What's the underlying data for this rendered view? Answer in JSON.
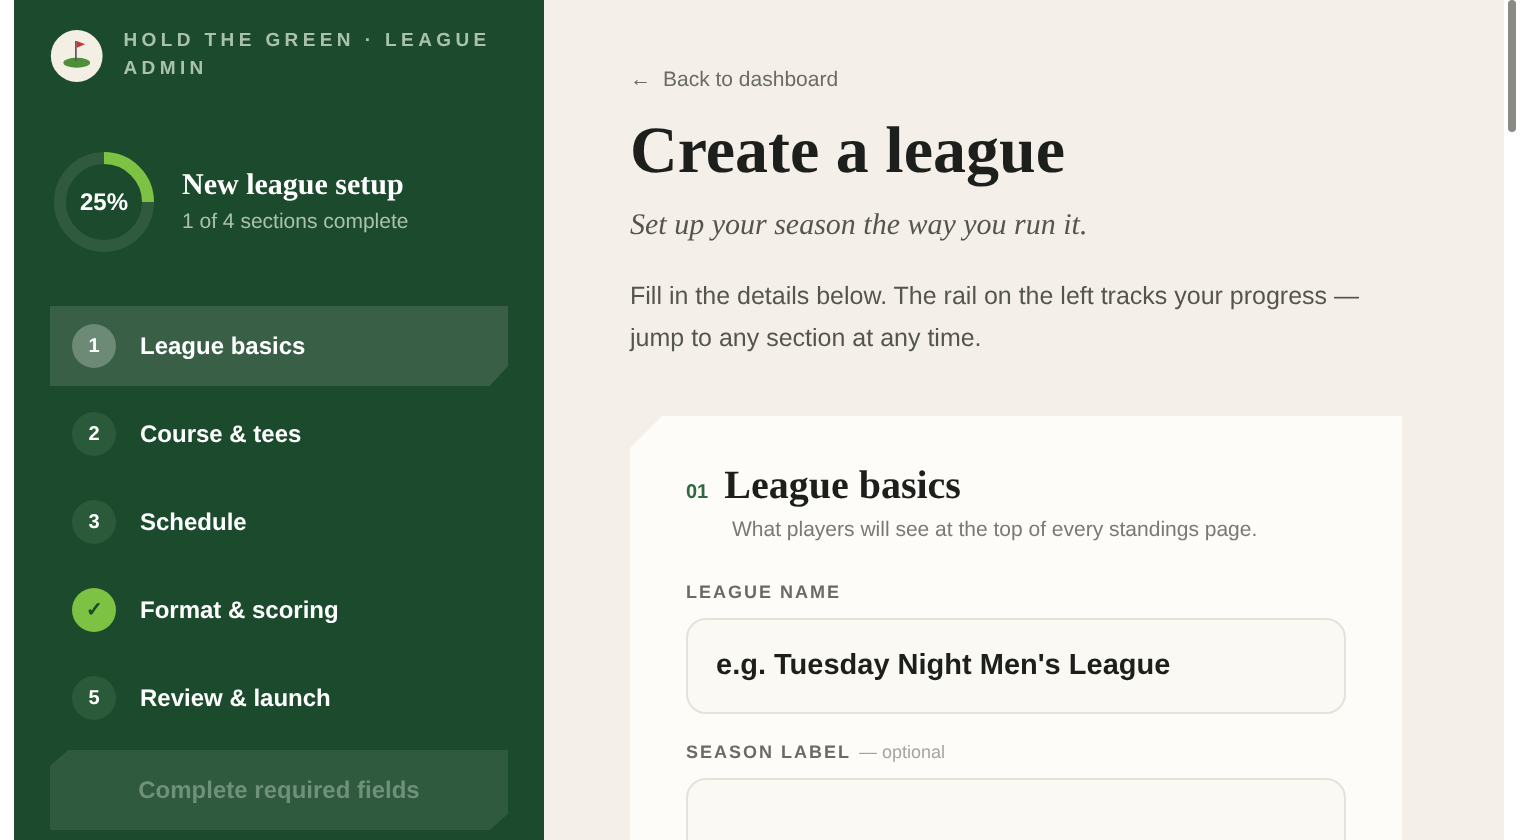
{
  "brand": {
    "name": "HOLD THE GREEN · LEAGUE ADMIN"
  },
  "progress": {
    "percent": "25%",
    "title": "New league setup",
    "subtitle": "1 of 4 sections complete"
  },
  "steps": [
    {
      "marker": "1",
      "label": "League basics",
      "kind": "number",
      "selected": true
    },
    {
      "marker": "2",
      "label": "Course & tees",
      "kind": "number",
      "selected": false
    },
    {
      "marker": "3",
      "label": "Schedule",
      "kind": "number",
      "selected": false
    },
    {
      "marker": "✓",
      "label": "Format & scoring",
      "kind": "done",
      "selected": false
    },
    {
      "marker": "5",
      "label": "Review & launch",
      "kind": "number",
      "selected": false
    }
  ],
  "submit": {
    "label": "Complete required fields",
    "disabled": true
  },
  "main": {
    "back": {
      "arrow": "←",
      "label": "Back to dashboard"
    },
    "title": "Create a league",
    "tagline": "Set up your season the way you run it.",
    "intro": "Fill in the details below. The rail on the left tracks your progress — jump to any section at any time."
  },
  "section": {
    "number": "01",
    "title": "League basics",
    "description": "What players will see at the top of every standings page.",
    "fields": [
      {
        "label": "LEAGUE NAME",
        "placeholder": "e.g. Tuesday Night Men's League"
      },
      {
        "label": "SEASON LABEL",
        "note": "— optional"
      }
    ]
  }
}
